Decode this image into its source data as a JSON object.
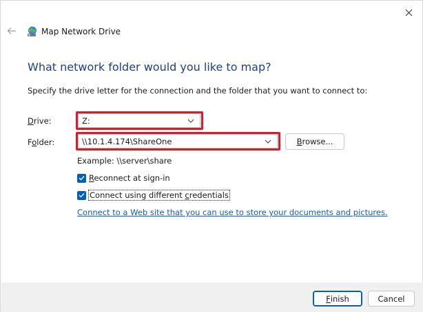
{
  "window": {
    "title": "Map Network Drive"
  },
  "heading": "What network folder would you like to map?",
  "instruction": "Specify the drive letter for the connection and the folder that you want to connect to:",
  "drive": {
    "label_prefix": "D",
    "label_rest": "rive:",
    "value": "Z:"
  },
  "folder": {
    "label_prefix": "F",
    "label_o": "o",
    "label_rest": "lder:",
    "value": "\\\\10.1.4.174\\ShareOne",
    "browse_prefix": "B",
    "browse_rest": "rowse..."
  },
  "example": "Example: \\\\server\\share",
  "reconnect": {
    "prefix": "R",
    "rest": "econnect at sign-in",
    "checked": true
  },
  "credentials": {
    "prefix": "Connect using different ",
    "underlined": "c",
    "rest": "redentials",
    "checked": true
  },
  "link": {
    "text": "Connect to a Web site that you can use to store your documents and pictures",
    "period": "."
  },
  "buttons": {
    "finish_prefix": "F",
    "finish_rest": "inish",
    "cancel": "Cancel"
  },
  "colors": {
    "heading": "#1e3f8a",
    "accent": "#005fb8",
    "highlight": "#d01f2e",
    "link": "#0f5fbe"
  }
}
